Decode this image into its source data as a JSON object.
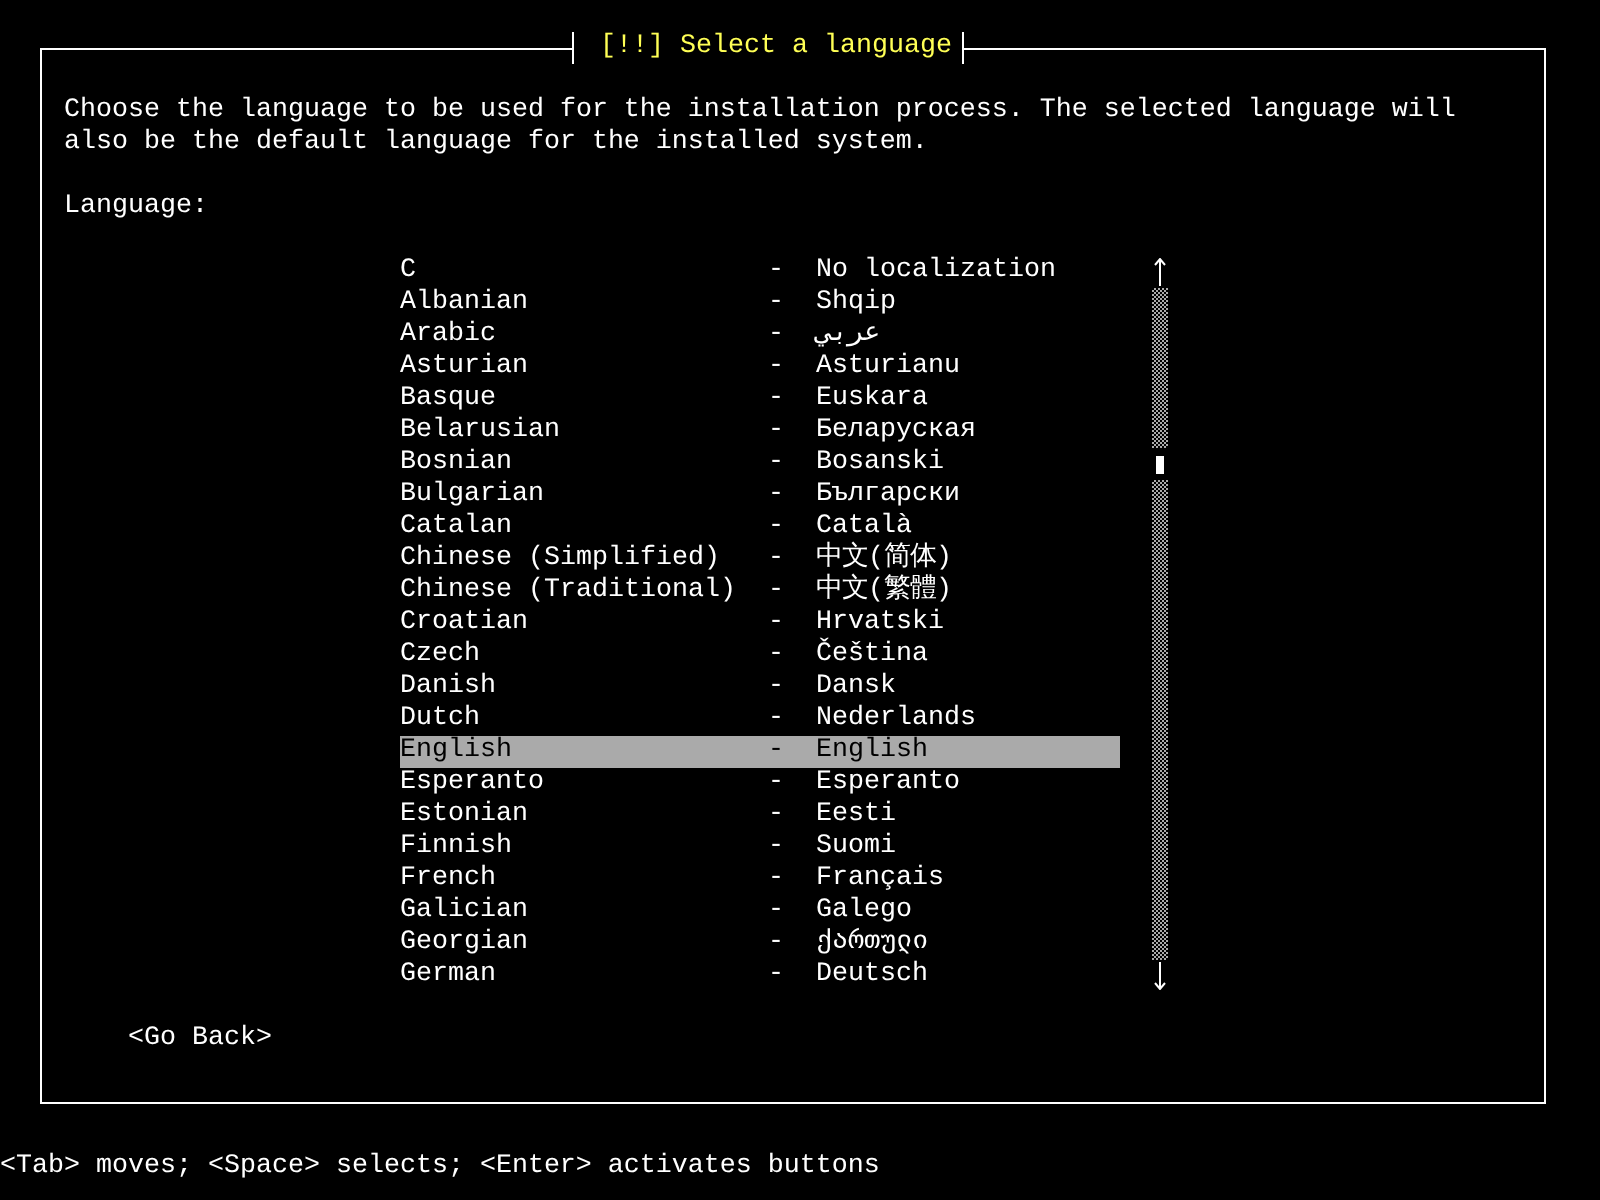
{
  "dialog": {
    "title": "[!!] Select a language",
    "description": "Choose the language to be used for the installation process. The selected language will also be the default language for the installed system.",
    "list_label": "Language:",
    "languages": [
      {
        "name": "C",
        "dash": "-",
        "native": "No localization",
        "selected": false
      },
      {
        "name": "Albanian",
        "dash": "-",
        "native": "Shqip",
        "selected": false
      },
      {
        "name": "Arabic",
        "dash": "-",
        "native": "عربي",
        "selected": false
      },
      {
        "name": "Asturian",
        "dash": "-",
        "native": "Asturianu",
        "selected": false
      },
      {
        "name": "Basque",
        "dash": "-",
        "native": "Euskara",
        "selected": false
      },
      {
        "name": "Belarusian",
        "dash": "-",
        "native": "Беларуская",
        "selected": false
      },
      {
        "name": "Bosnian",
        "dash": "-",
        "native": "Bosanski",
        "selected": false
      },
      {
        "name": "Bulgarian",
        "dash": "-",
        "native": "Български",
        "selected": false
      },
      {
        "name": "Catalan",
        "dash": "-",
        "native": "Català",
        "selected": false
      },
      {
        "name": "Chinese (Simplified)",
        "dash": "-",
        "native": "中文(简体)",
        "selected": false
      },
      {
        "name": "Chinese (Traditional)",
        "dash": "-",
        "native": "中文(繁體)",
        "selected": false
      },
      {
        "name": "Croatian",
        "dash": "-",
        "native": "Hrvatski",
        "selected": false
      },
      {
        "name": "Czech",
        "dash": "-",
        "native": "Čeština",
        "selected": false
      },
      {
        "name": "Danish",
        "dash": "-",
        "native": "Dansk",
        "selected": false
      },
      {
        "name": "Dutch",
        "dash": "-",
        "native": "Nederlands",
        "selected": false
      },
      {
        "name": "English",
        "dash": "-",
        "native": "English",
        "selected": true
      },
      {
        "name": "Esperanto",
        "dash": "-",
        "native": "Esperanto",
        "selected": false
      },
      {
        "name": "Estonian",
        "dash": "-",
        "native": "Eesti",
        "selected": false
      },
      {
        "name": "Finnish",
        "dash": "-",
        "native": "Suomi",
        "selected": false
      },
      {
        "name": "French",
        "dash": "-",
        "native": "Français",
        "selected": false
      },
      {
        "name": "Galician",
        "dash": "-",
        "native": "Galego",
        "selected": false
      },
      {
        "name": "Georgian",
        "dash": "-",
        "native": "ქართული",
        "selected": false
      },
      {
        "name": "German",
        "dash": "-",
        "native": "Deutsch",
        "selected": false
      }
    ],
    "back_button": {
      "label": "<Go Back>"
    }
  },
  "help_bar": "<Tab> moves; <Space> selects; <Enter> activates buttons"
}
